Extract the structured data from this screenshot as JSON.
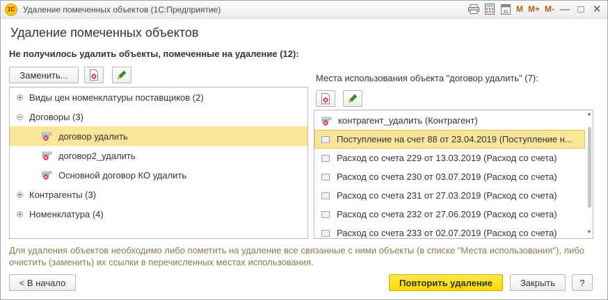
{
  "window": {
    "title": "Удаление помеченных объектов  (1С:Предприятие)",
    "logo_text": "1С",
    "tools": {
      "m": "M",
      "m_plus": "M+",
      "m_minus": "M-"
    }
  },
  "page": {
    "title": "Удаление помеченных объектов",
    "section_label": "Не получилось удалить объекты, помеченные на удаление (12):"
  },
  "left_toolbar": {
    "replace_label": "Заменить..."
  },
  "tree": [
    {
      "label": "Виды цен номенклатуры поставщиков (2)",
      "kind": "group",
      "expanded": false
    },
    {
      "label": "Договоры (3)",
      "kind": "group",
      "expanded": true
    },
    {
      "label": "договор удалить",
      "kind": "item",
      "selected": true
    },
    {
      "label": "договор2_удалить",
      "kind": "item"
    },
    {
      "label": "Основной договор КО удалить",
      "kind": "item"
    },
    {
      "label": "Контрагенты (3)",
      "kind": "group",
      "expanded": false
    },
    {
      "label": "Номенклатура (4)",
      "kind": "group",
      "expanded": false
    }
  ],
  "usage": {
    "label": "Места использования объекта \"договор удалить\" (7):",
    "rows": [
      {
        "label": "контрагент_удалить (Контрагент)",
        "icon": "marked-object-icon"
      },
      {
        "label": "Поступление на счет 88 от 23.04.2019  (Поступление н...",
        "icon": "document-icon",
        "selected": true
      },
      {
        "label": "Расход со счета 229 от 13.03.2019  (Расход со счета)",
        "icon": "document-icon"
      },
      {
        "label": "Расход со счета 230 от 03.07.2019  (Расход со счета)",
        "icon": "document-icon"
      },
      {
        "label": "Расход со счета 231 от 27.03.2019  (Расход со счета)",
        "icon": "document-icon"
      },
      {
        "label": "Расход со счета 232 от 27.06.2019  (Расход со счета)",
        "icon": "document-icon"
      },
      {
        "label": "Расход со счета 233 от 02.07.2019  (Расход со счета)",
        "icon": "document-icon"
      }
    ]
  },
  "info": "Для удаления объектов необходимо либо пометить на удаление все связанные с ними объекты (в списке \"Места использования\"), либо очистить (заменить) их ссылки в перечисленных местах использования.",
  "footer": {
    "back_label": "< В начало",
    "repeat_label": "Повторить удаление",
    "close_label": "Закрыть",
    "help_label": "?"
  },
  "colors": {
    "selection": "#fae59b",
    "primary_button": "#fcd700",
    "delete_mark": "#d6202a",
    "edit_icon": "#3a9a2a",
    "hint_text": "#8a7a4a"
  }
}
